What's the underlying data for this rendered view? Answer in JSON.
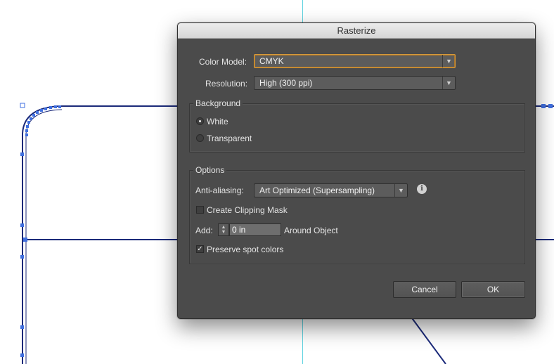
{
  "dialog": {
    "title": "Rasterize",
    "color_model": {
      "label": "Color Model:",
      "value": "CMYK"
    },
    "resolution": {
      "label": "Resolution:",
      "value": "High (300 ppi)"
    },
    "background": {
      "title": "Background",
      "options": [
        {
          "label": "White",
          "selected": true
        },
        {
          "label": "Transparent",
          "selected": false
        }
      ]
    },
    "options": {
      "title": "Options",
      "anti_aliasing": {
        "label": "Anti-aliasing:",
        "value": "Art Optimized (Supersampling)"
      },
      "info_icon": "i",
      "clipping_mask": {
        "label": "Create Clipping Mask",
        "checked": false
      },
      "add": {
        "label": "Add:",
        "value": "0 in",
        "suffix": "Around Object"
      },
      "preserve_spot": {
        "label": "Preserve spot colors",
        "checked": true
      }
    },
    "buttons": {
      "cancel": "Cancel",
      "ok": "OK"
    }
  },
  "glyphs": {
    "dropdown_arrow": "▼",
    "stepper_up": "▲",
    "stepper_down": "▼",
    "checkmark": "✓"
  },
  "colors": {
    "dialog_bg": "#4b4b4b",
    "focus_accent": "#d89a3a",
    "artwork_stroke": "#1b2a7a",
    "selection_handle": "#3f6fe0",
    "guide": "#5fd3e0"
  }
}
